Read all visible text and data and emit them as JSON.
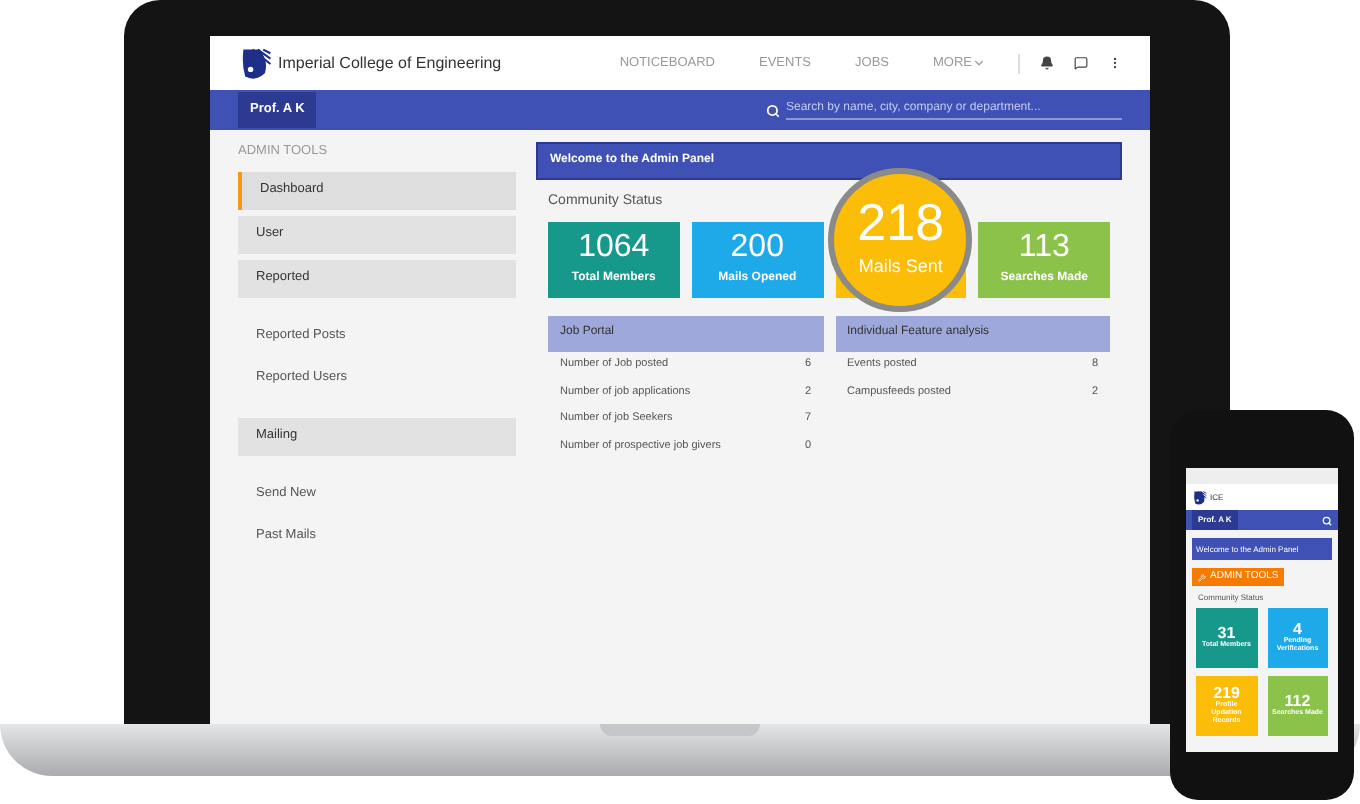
{
  "laptop": {
    "brand": "Imperial College of Engineering",
    "nav": [
      {
        "label": "NOTICEBOARD",
        "kind": "link"
      },
      {
        "label": "EVENTS",
        "kind": "link"
      },
      {
        "label": "JOBS",
        "kind": "link"
      },
      {
        "label": "MORE",
        "kind": "menu"
      }
    ],
    "user": "Prof. A K",
    "search": {
      "placeholder": "Search by name, city, company or department..."
    },
    "sidebar": {
      "heading": "ADMIN TOOLS",
      "items": [
        {
          "label": "Dashboard",
          "kind": "group",
          "selected": true
        },
        {
          "label": "User",
          "kind": "group",
          "selected": false
        },
        {
          "label": "Reported",
          "kind": "group",
          "selected": false
        },
        {
          "label": "Reported Posts",
          "kind": "link",
          "selected": false
        },
        {
          "label": "Reported Users",
          "kind": "link",
          "selected": false
        },
        {
          "label": "Mailing",
          "kind": "group",
          "selected": false
        },
        {
          "label": "Send New",
          "kind": "link",
          "selected": false
        },
        {
          "label": "Past Mails",
          "kind": "link",
          "selected": false
        }
      ]
    },
    "welcome": "Welcome to the Admin Panel",
    "section_title": "Community Status",
    "stats": [
      {
        "value": "1064",
        "label": "Total Members",
        "color": "#16988a",
        "magnified": false
      },
      {
        "value": "200",
        "label": "Mails Opened",
        "color": "#1ea9e9",
        "magnified": false
      },
      {
        "value": "218",
        "label": "Mails Sent",
        "color": "#fbbd08",
        "magnified": true
      },
      {
        "value": "113",
        "label": "Searches Made",
        "color": "#8bc34a",
        "magnified": false
      }
    ],
    "tables": [
      {
        "title": "Job Portal",
        "rows": [
          {
            "label": "Number of Job posted",
            "value": "6"
          },
          {
            "label": "Number of job applications",
            "value": "2"
          },
          {
            "label": "Number of job Seekers",
            "value": "7"
          },
          {
            "label": "Number of prospective job givers",
            "value": "0"
          }
        ]
      },
      {
        "title": "Individual Feature analysis",
        "rows": [
          {
            "label": "Events posted",
            "value": "8"
          },
          {
            "label": "Campusfeeds posted",
            "value": "2"
          }
        ]
      }
    ]
  },
  "phone": {
    "brand": "ICE",
    "user": "Prof. A K",
    "welcome": "Welcome to the Admin Panel",
    "admin_button": "ADMIN TOOLS",
    "section_title": "Community Status",
    "stats": [
      {
        "value": "31",
        "label": "Total Members",
        "color": "#16988a"
      },
      {
        "value": "4",
        "label": "Pending Verifications",
        "color": "#1ea9e9"
      },
      {
        "value": "219",
        "label": "Profile Updation Records",
        "color": "#fbbd08"
      },
      {
        "value": "112",
        "label": "Searches Made",
        "color": "#8bc34a"
      }
    ]
  }
}
